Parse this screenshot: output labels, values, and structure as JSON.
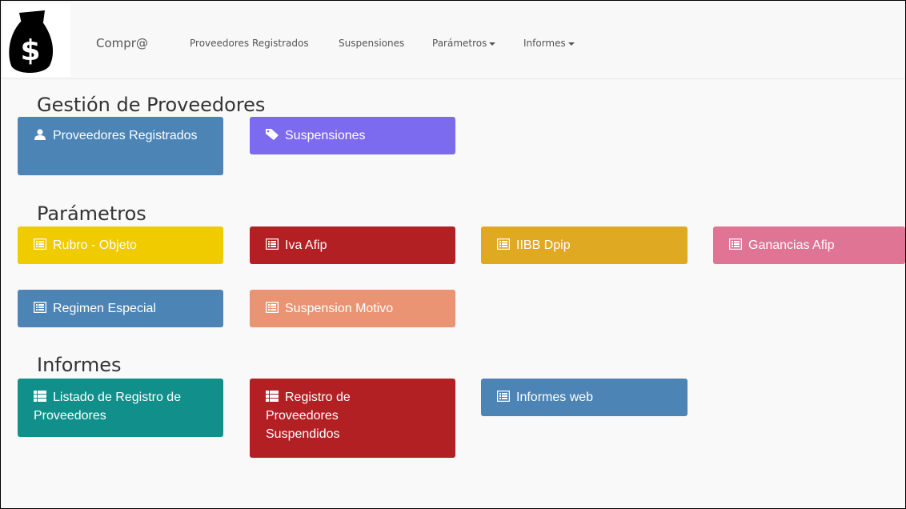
{
  "navbar": {
    "brand": "Compr@",
    "links": [
      "Proveedores Registrados",
      "Suspensiones",
      "Parámetros",
      "Informes"
    ],
    "logo_icon": "money-bag-dollar-icon"
  },
  "sections": {
    "gestion": {
      "title": "Gestión de Proveedores",
      "tiles": [
        {
          "label": "Proveedores Registrados",
          "icon": "user-icon",
          "color": "#4c84b6"
        },
        {
          "label": "Suspensiones",
          "icon": "tag-icon",
          "color": "#7d6bef"
        }
      ]
    },
    "parametros": {
      "title": "Parámetros",
      "tiles": [
        {
          "label": "Rubro - Objeto",
          "icon": "list-alt-icon",
          "color": "#f0cb00"
        },
        {
          "label": "Iva Afip",
          "icon": "list-alt-icon",
          "color": "#b32024"
        },
        {
          "label": "IIBB Dpip",
          "icon": "list-alt-icon",
          "color": "#e0a922"
        },
        {
          "label": "Ganancias Afip",
          "icon": "list-alt-icon",
          "color": "#df7495"
        },
        {
          "label": "Regimen Especial",
          "icon": "list-alt-icon",
          "color": "#4c84b6"
        },
        {
          "label": "Suspension Motivo",
          "icon": "list-alt-icon",
          "color": "#ea9473"
        }
      ]
    },
    "informes": {
      "title": "Informes",
      "tiles": [
        {
          "label": "Listado de Registro de Proveedores",
          "icon": "th-list-icon",
          "color": "#118f8b"
        },
        {
          "label": "Registro de Proveedores Suspendidos",
          "icon": "th-list-icon",
          "color": "#b32024"
        },
        {
          "label": "Informes web",
          "icon": "list-alt-icon",
          "color": "#4c84b6"
        }
      ]
    }
  }
}
